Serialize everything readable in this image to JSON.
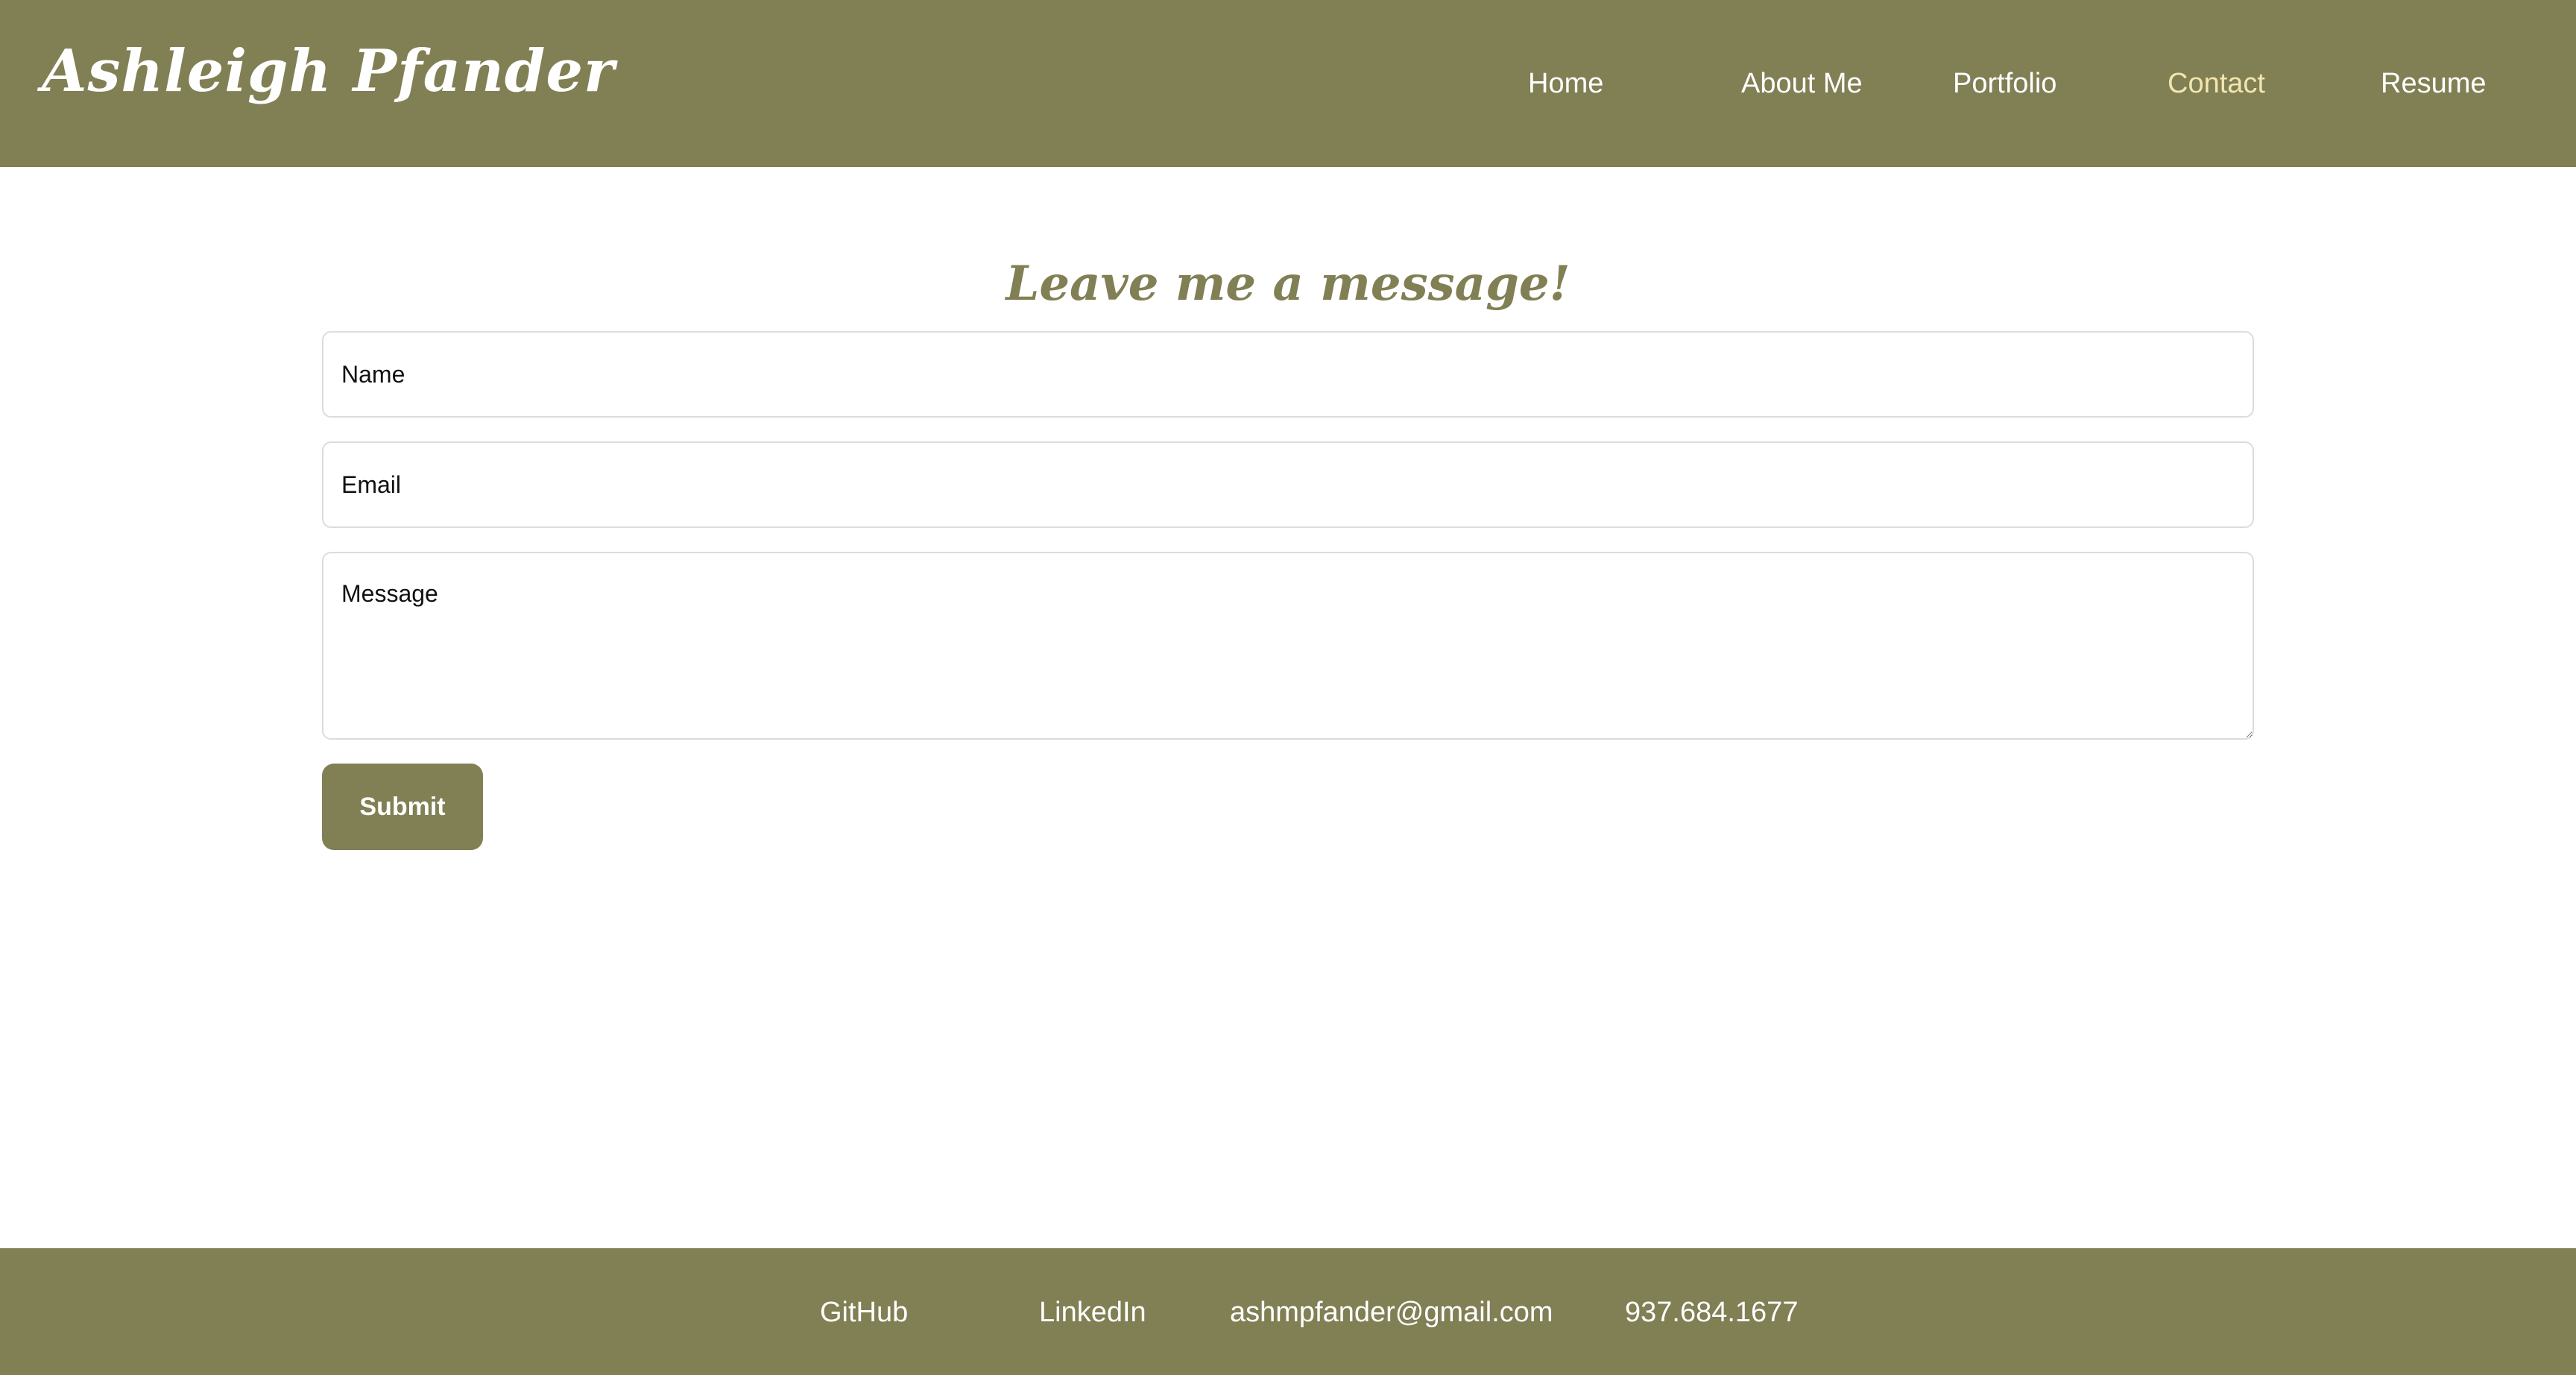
{
  "header": {
    "brand": "Ashleigh Pfander",
    "nav": {
      "home": "Home",
      "about": "About Me",
      "portfolio": "Portfolio",
      "contact": "Contact",
      "resume": "Resume"
    },
    "active_nav": "Contact"
  },
  "main": {
    "heading": "Leave me a message!",
    "form": {
      "name_placeholder": "Name",
      "name_value": "",
      "email_placeholder": "Email",
      "email_value": "",
      "message_placeholder": "Message",
      "message_value": "",
      "submit_label": "Submit"
    }
  },
  "footer": {
    "github": "GitHub",
    "linkedin": "LinkedIn",
    "email": "ashmpfander@gmail.com",
    "phone": "937.684.1677"
  },
  "colors": {
    "brand": "#817f54",
    "active_nav": "#f2e6b0",
    "text_on_brand": "#ffffff"
  }
}
